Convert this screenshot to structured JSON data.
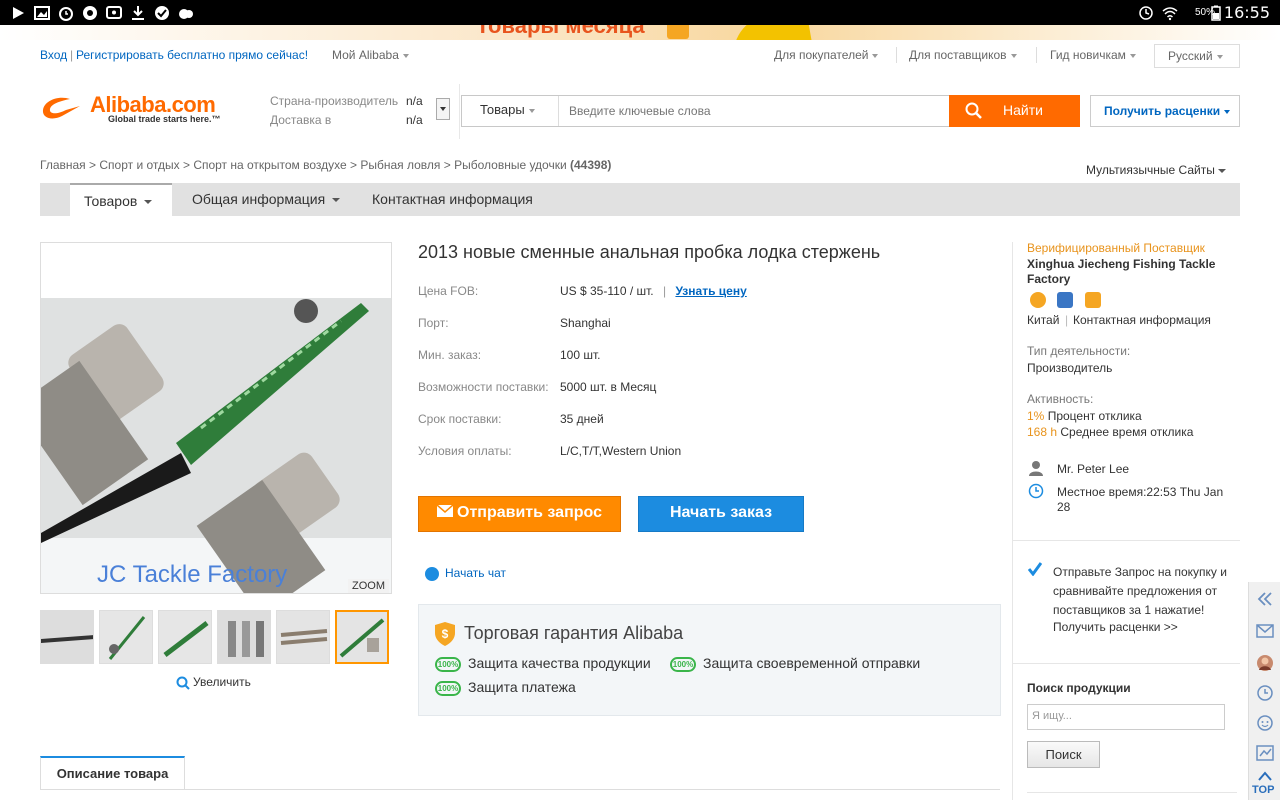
{
  "status_bar": {
    "time": "16:55",
    "battery": "50%"
  },
  "banner": {
    "text": "Товары месяца"
  },
  "topnav": {
    "login": "Вход",
    "register": "Регистрировать бесплатно прямо сейчас!",
    "my_alibaba": "Мой Alibaba",
    "for_buyers": "Для покупателей",
    "for_suppliers": "Для поставщиков",
    "beginner_guide": "Гид новичкам",
    "language": "Русский"
  },
  "logo": {
    "name": "Alibaba.com",
    "tagline": "Global trade starts here.™"
  },
  "origin": {
    "country_label": "Страна-производитель",
    "country_value": "n/a",
    "ship_label": "Доставка в",
    "ship_value": "n/a"
  },
  "search": {
    "category": "Товары",
    "placeholder": "Введите ключевые слова",
    "button": "Найти",
    "quote_button": "Получить расценки"
  },
  "breadcrumb": {
    "items": [
      "Главная",
      "Спорт и отдых",
      "Спорт на открытом воздухе",
      "Рыбная ловля",
      "Рыболовные удочки"
    ],
    "count": "(44398)",
    "multilang": "Мультиязычные Сайты"
  },
  "tabs": [
    "Товаров",
    "Общая информация",
    "Контактная информация"
  ],
  "product": {
    "title": "2013 новые сменные анальная пробка лодка стержень",
    "watermark": "JC Tackle Factory",
    "zoom": "ZOOM",
    "enlarge": "Увеличить",
    "fields": [
      {
        "label": "Цена FOB:",
        "value": "US $ 35-110 / шт."
      },
      {
        "label": "Порт:",
        "value": "Shanghai"
      },
      {
        "label": "Мин. заказ:",
        "value": "100 шт."
      },
      {
        "label": "Возможности поставки:",
        "value": "5000 шт. в Месяц"
      },
      {
        "label": "Срок поставки:",
        "value": "35 дней"
      },
      {
        "label": "Условия оплаты:",
        "value": "L/C,T/T,Western Union"
      }
    ],
    "price_link": "Узнать цену",
    "inquiry_button": "Отправить запрос",
    "order_button": "Начать заказ",
    "chat": "Начать чат"
  },
  "trade_assurance": {
    "title": "Торговая гарантия Alibaba",
    "badge": "100%",
    "items": [
      "Защита качества продукции",
      "Защита своевременной отправки",
      "Защита платежа"
    ]
  },
  "description_tab": "Описание товара",
  "supplier": {
    "verified": "Верифицированный Поставщик",
    "name": "Xinghua Jiecheng Fishing Tackle Factory",
    "country": "Китай",
    "contact": "Контактная информация",
    "business_type_label": "Тип деятельности:",
    "business_type": "Производитель",
    "activity_label": "Активность:",
    "response_rate_value": "1%",
    "response_rate_label": "Процент отклика",
    "response_time_value": "168 h",
    "response_time_label": "Среднее время отклика",
    "contact_person": "Mr. Peter Lee",
    "local_time": "Местное время:22:53 Thu Jan 28"
  },
  "rfq": {
    "text": "Отправьте Запрос на покупку и сравнивайте предложения от поставщиков за 1 нажатие!",
    "link": "Получить расценки >>"
  },
  "product_search": {
    "title": "Поиск продукции",
    "placeholder": "Я ищу...",
    "button": "Поиск"
  },
  "sidebar": {
    "top": "TOP"
  },
  "colors": {
    "accent_orange": "#ff6a00",
    "link_blue": "#0066c0",
    "order_blue": "#1c8ce0",
    "trade_green": "#3ab54a"
  }
}
